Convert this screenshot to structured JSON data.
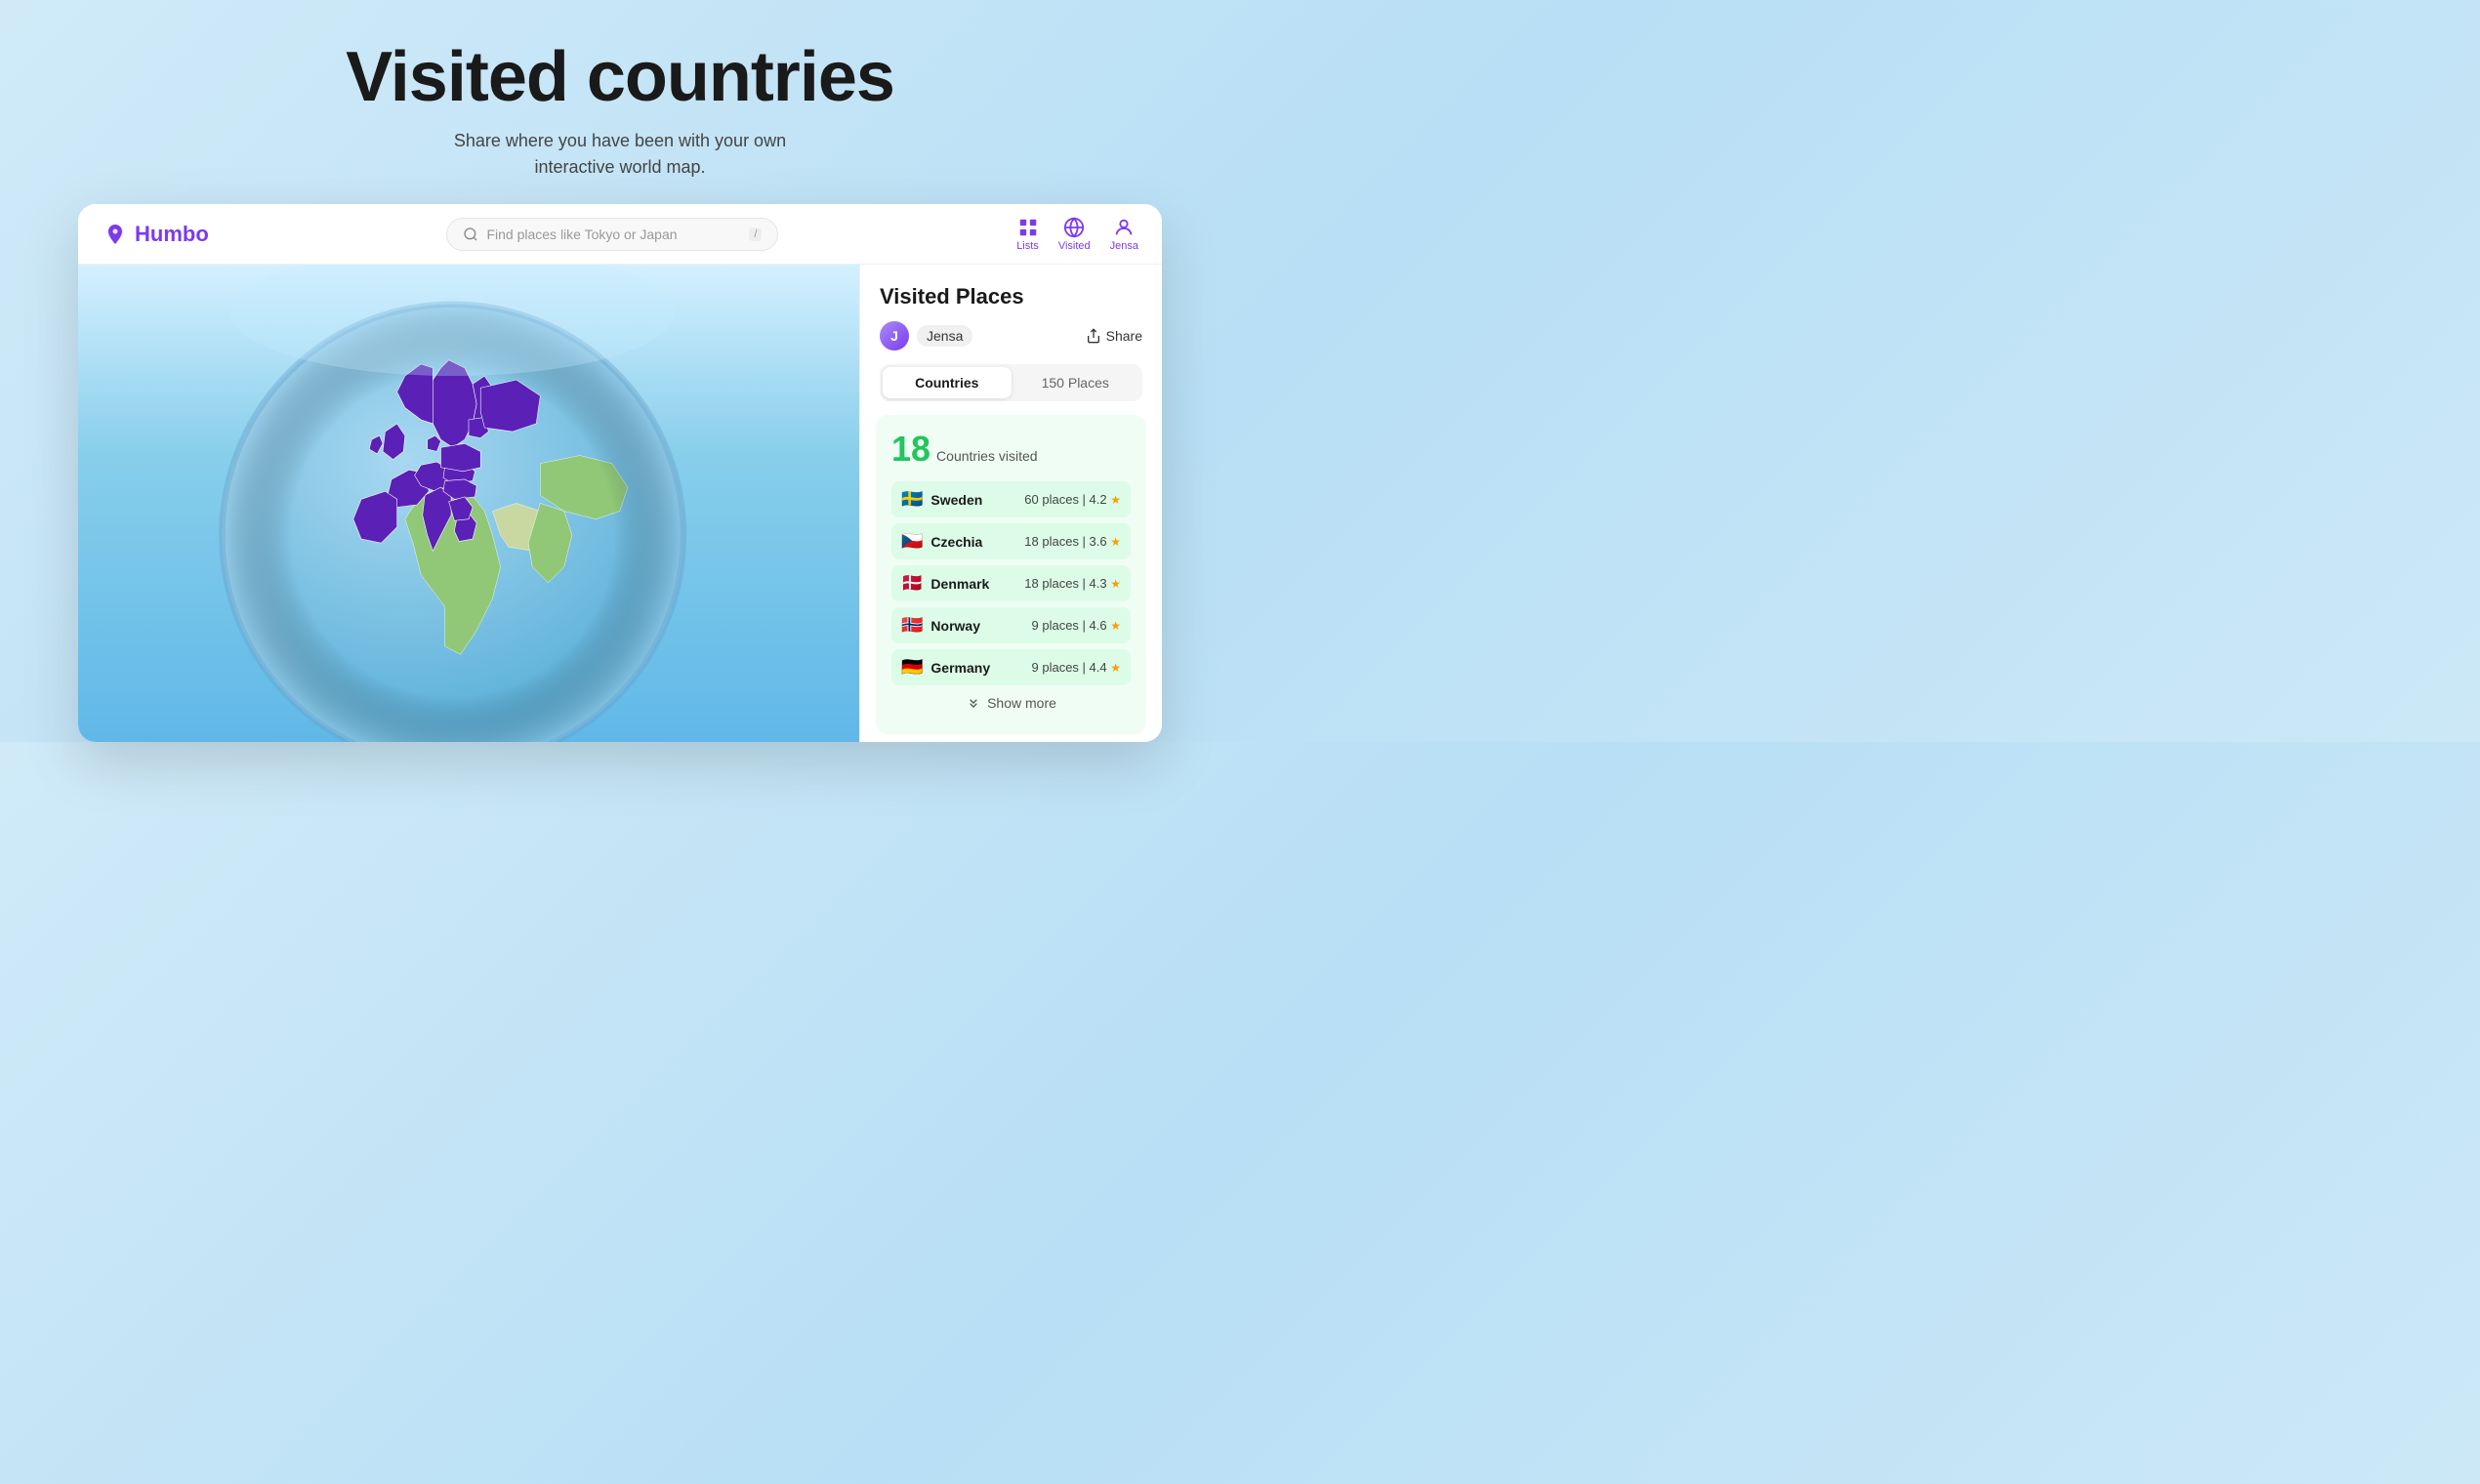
{
  "hero": {
    "title": "Visited countries",
    "subtitle": "Share where you have been with your own\ninteractive world map."
  },
  "nav": {
    "logo_text": "Humbo",
    "search_placeholder": "Find places like Tokyo or Japan",
    "search_shortcut": "/",
    "items": [
      {
        "label": "Lists",
        "icon": "list-icon"
      },
      {
        "label": "Visited",
        "icon": "globe-icon"
      },
      {
        "label": "Jensa",
        "icon": "user-icon"
      }
    ]
  },
  "sidebar": {
    "title": "Visited Places",
    "user": {
      "name": "Jensa",
      "avatar_initial": "J"
    },
    "share_label": "Share",
    "tabs": [
      {
        "label": "Countries",
        "active": true
      },
      {
        "label": "150 Places",
        "active": false
      }
    ],
    "stats": {
      "count": 18,
      "label": "Countries visited"
    },
    "countries": [
      {
        "flag": "🇸🇪",
        "name": "Sweden",
        "places": 60,
        "rating": "4.2"
      },
      {
        "flag": "🇨🇿",
        "name": "Czechia",
        "places": 18,
        "rating": "3.6"
      },
      {
        "flag": "🇩🇰",
        "name": "Denmark",
        "places": 18,
        "rating": "4.3"
      },
      {
        "flag": "🇳🇴",
        "name": "Norway",
        "places": 9,
        "rating": "4.6"
      },
      {
        "flag": "🇩🇪",
        "name": "Germany",
        "places": 9,
        "rating": "4.4"
      }
    ],
    "show_more_label": "Show more"
  }
}
